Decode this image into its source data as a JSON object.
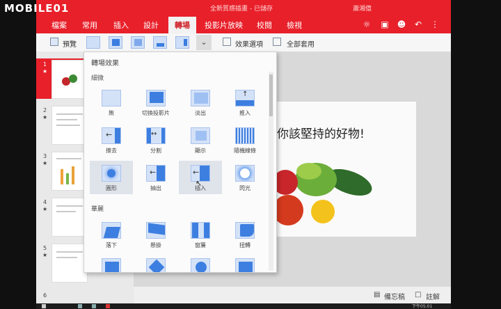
{
  "watermark": "MOBILE01",
  "app": {
    "title": "全新質感插畫 - 已儲存",
    "user": "蕭湘億"
  },
  "tabs": [
    {
      "label": "檔案"
    },
    {
      "label": "常用"
    },
    {
      "label": "插入"
    },
    {
      "label": "設計"
    },
    {
      "label": "轉場"
    },
    {
      "label": "投影片放映"
    },
    {
      "label": "校閱"
    },
    {
      "label": "檢視"
    }
  ],
  "ribbon": {
    "preview_label": "預覽",
    "effect_options_label": "效果選項",
    "apply_all_label": "全部套用"
  },
  "panel": {
    "title": "轉場效果",
    "section_subtle": "細微",
    "section_exciting": "華麗",
    "subtle_items": [
      {
        "label": "無"
      },
      {
        "label": "切換投影片"
      },
      {
        "label": "淡出"
      },
      {
        "label": "推入"
      },
      {
        "label": "擦去"
      },
      {
        "label": "分割"
      },
      {
        "label": "顯示"
      },
      {
        "label": "隨機線條"
      },
      {
        "label": "圓形"
      },
      {
        "label": "抽出"
      },
      {
        "label": "插入"
      },
      {
        "label": "閃光"
      }
    ],
    "exciting_items": [
      {
        "label": "落下"
      },
      {
        "label": "懸掛"
      },
      {
        "label": "窗簾"
      },
      {
        "label": "扭轉"
      },
      {
        "label": ""
      },
      {
        "label": ""
      },
      {
        "label": ""
      },
      {
        "label": ""
      }
    ]
  },
  "slides": [
    {
      "num": "1"
    },
    {
      "num": "2"
    },
    {
      "num": "3"
    },
    {
      "num": "4"
    },
    {
      "num": "5"
    },
    {
      "num": "6"
    }
  ],
  "slide": {
    "text": "你該堅持的好物!"
  },
  "status": {
    "notes_label": "備忘稿",
    "comments_label": "註解"
  },
  "taskbar": {
    "time": "下午05:01"
  }
}
